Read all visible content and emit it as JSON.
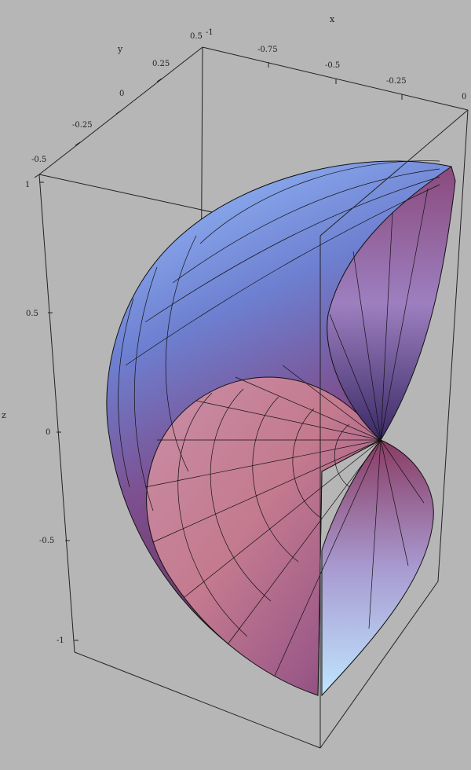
{
  "axes": {
    "x": {
      "label": "x",
      "ticks": [
        "-0.75",
        "-0.5",
        "-0.25",
        "0"
      ]
    },
    "y": {
      "label": "y",
      "ticks": [
        "-0.5",
        "-0.25",
        "0",
        "0.25",
        "0.5"
      ]
    },
    "z": {
      "label": "z",
      "ticks": [
        "1",
        "0.5",
        "0",
        "-0.5",
        "-1"
      ]
    },
    "corner_x_label": "-1"
  },
  "colors": {
    "background": "#b6b6b6",
    "box": "#222222",
    "outer_top": "#8fb0f0",
    "outer_bottom": "#8a3f70",
    "inner_top": "#a47ab4",
    "inner_bottom": "#b8c0e8",
    "front_face": "#b86a8a"
  }
}
